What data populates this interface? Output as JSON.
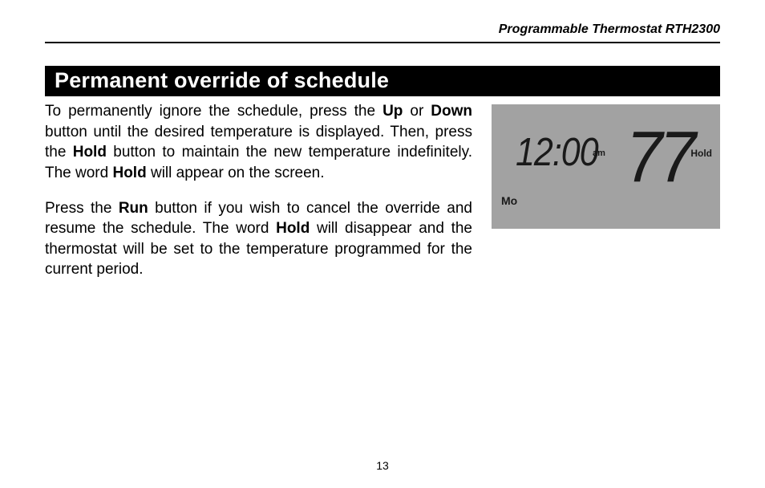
{
  "header": {
    "title": "Programmable Thermostat RTH2300"
  },
  "section": {
    "title": "Permanent override of schedule"
  },
  "body": {
    "p1_a": "To permanently ignore the schedule, press the ",
    "p1_up": "Up",
    "p1_b": " or ",
    "p1_down": "Down",
    "p1_c": " button until the desired temperature is displayed. Then, press the ",
    "p1_hold": "Hold",
    "p1_d": " button to maintain the new temperature indefinitely. The word ",
    "p1_hold2": "Hold",
    "p1_e": " will appear on the screen.",
    "p2_a": "Press the ",
    "p2_run": "Run",
    "p2_b": " button if you wish to cancel the override and resume the schedule. The word ",
    "p2_hold": "Hold",
    "p2_c": " will disappear and the thermostat will be set to the temperature programmed for the current period."
  },
  "display": {
    "time": "12:00",
    "ampm": "am",
    "temperature": "77",
    "degree": "°",
    "status": "Hold",
    "day": "Mo"
  },
  "page_number": "13"
}
